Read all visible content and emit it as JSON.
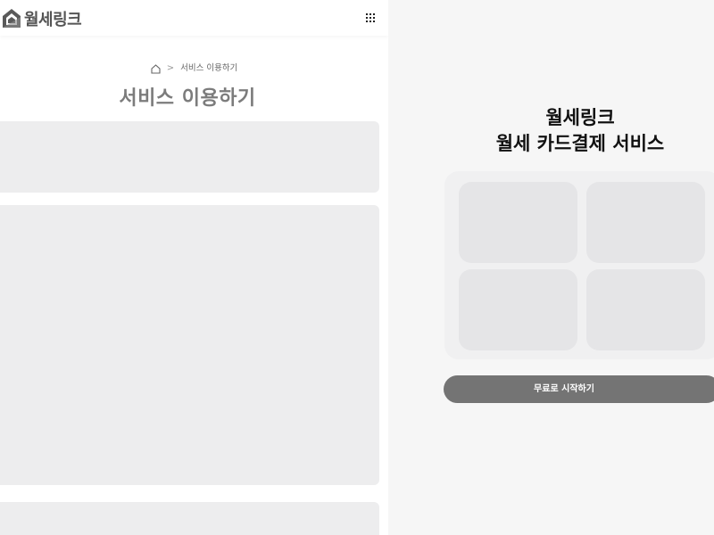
{
  "header": {
    "logo_text": "월세링크",
    "logo_icon": "house-logo-icon",
    "menu_icon": "grid-menu-icon"
  },
  "breadcrumb": {
    "home_icon": "home-icon",
    "separator": ">",
    "current": "서비스 이용하기"
  },
  "page": {
    "title": "서비스 이용하기"
  },
  "hero": {
    "title_line1": "월세링크",
    "title_line2": "월세 카드결제 서비스"
  },
  "cta": {
    "label": "무료로 시작하기"
  },
  "colors": {
    "skeleton": "#ededee",
    "cta_bg": "#747474",
    "logo_gray": "#555555"
  }
}
